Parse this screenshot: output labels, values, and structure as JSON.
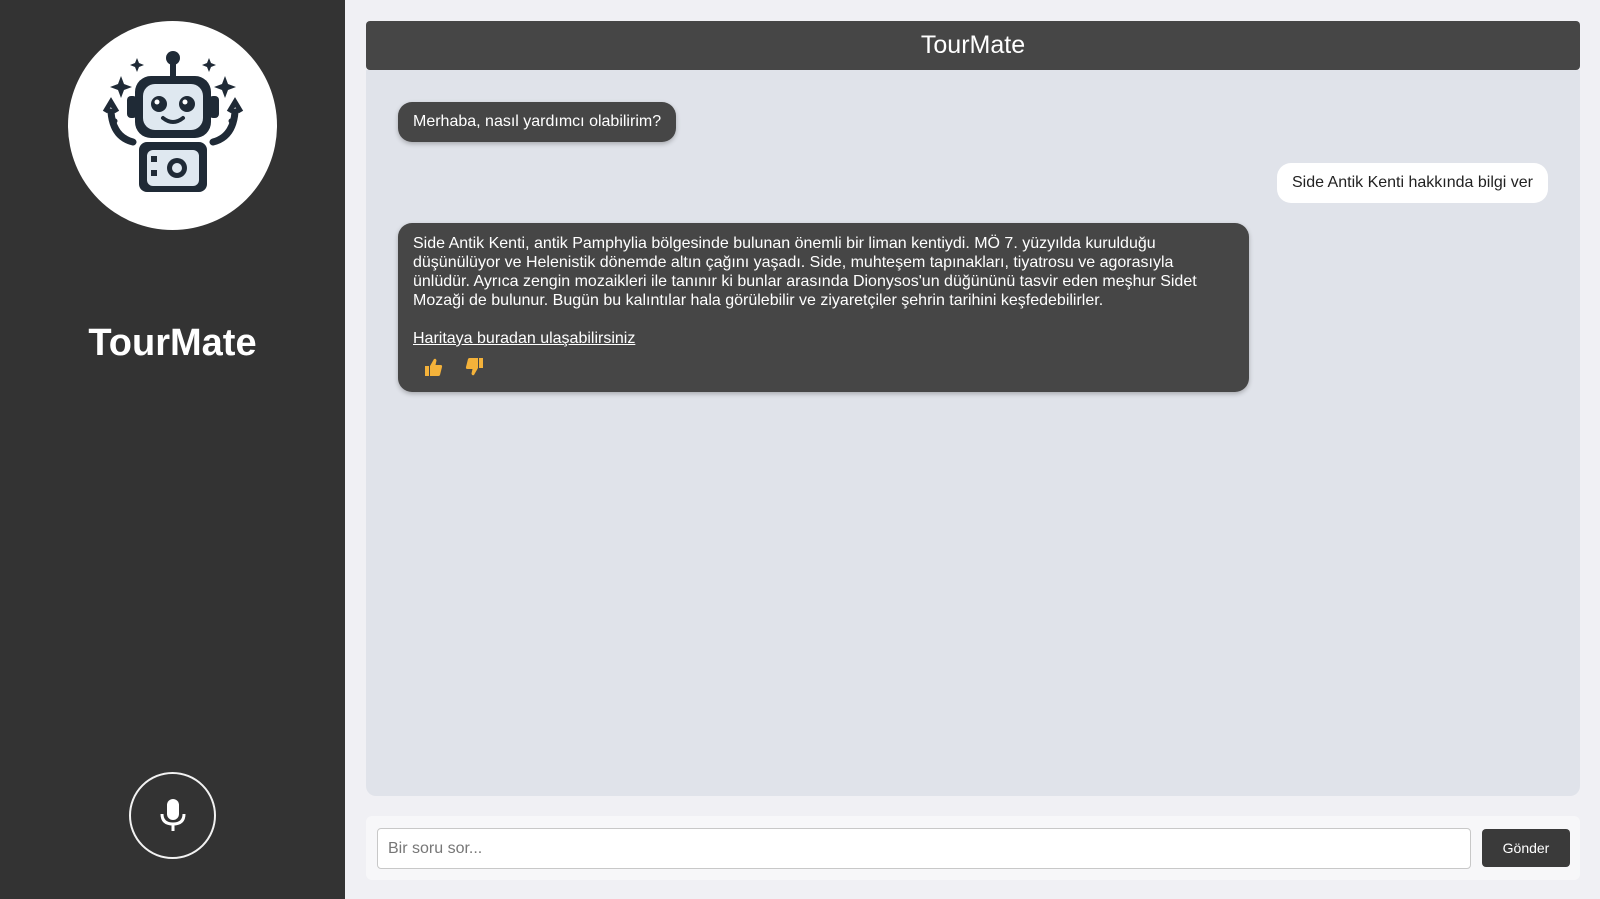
{
  "sidebar": {
    "brand_name": "TourMate",
    "avatar_icon": "robot-icon",
    "mic_icon": "microphone-icon"
  },
  "header": {
    "title": "TourMate"
  },
  "messages": [
    {
      "sender": "bot",
      "text": "Merhaba, nasıl yardımcı olabilirim?"
    },
    {
      "sender": "user",
      "text": "Side Antik Kenti hakkında bilgi ver"
    },
    {
      "sender": "bot",
      "text": "Side Antik Kenti, antik Pamphylia bölgesinde bulunan önemli bir liman kentiydi. MÖ 7. yüzyılda kurulduğu düşünülüyor ve Helenistik dönemde altın çağını yaşadı. Side, muhteşem tapınakları, tiyatrosu ve agorasıyla ünlüdür. Ayrıca zengin mozaikleri ile tanınır ki bunlar arasında Dionysos'un düğününü tasvir eden meşhur Sidet Mozaği de bulunur. Bugün bu kalıntılar hala görülebilir ve ziyaretçiler şehrin tarihini keşfedebilirler.",
      "link_text": "Haritaya buradan ulaşabilirsiniz",
      "feedback": {
        "like_icon": "thumbs-up-icon",
        "dislike_icon": "thumbs-down-icon"
      }
    }
  ],
  "input": {
    "placeholder": "Bir soru sor...",
    "value": "",
    "send_label": "Gönder"
  },
  "colors": {
    "sidebar_bg": "#333333",
    "bubble_dark": "#464646",
    "chat_bg": "#e0e3ea",
    "thumb_yellow": "#f4b23a"
  }
}
